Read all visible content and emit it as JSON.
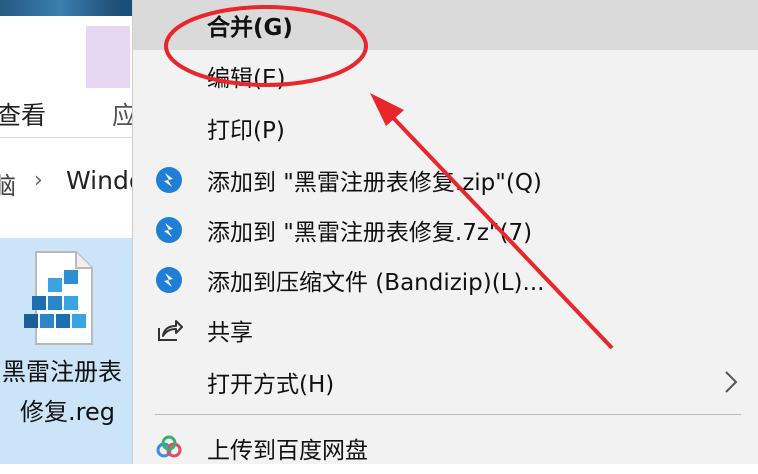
{
  "explorer": {
    "view_tab_label": "查看",
    "partial_tab_label": "应",
    "address_prefix": "脑",
    "address_separator": "›",
    "address_path": "Windo",
    "file_name_line1": "黑雷注册表",
    "file_name_line2": "修复.reg"
  },
  "context_menu": {
    "items": [
      {
        "label": "合并(G)",
        "icon": null,
        "highlighted": true
      },
      {
        "label": "编辑(E)",
        "icon": null
      },
      {
        "label": "打印(P)",
        "icon": null
      },
      {
        "label": "添加到 \"黑雷注册表修复.zip\"(Q)",
        "icon": "bandizip-icon"
      },
      {
        "label": "添加到 \"黑雷注册表修复.7z\"(7)",
        "icon": "bandizip-icon"
      },
      {
        "label": "添加到压缩文件 (Bandizip)(L)...",
        "icon": "bandizip-icon"
      },
      {
        "label": "共享",
        "icon": "share-icon"
      },
      {
        "label": "打开方式(H)",
        "icon": null,
        "submenu": true
      },
      {
        "label": "上传到百度网盘",
        "icon": "baidu-netdisk-icon"
      }
    ]
  },
  "colors": {
    "menu_bg": "#f2f2f2",
    "highlight_bg": "#dadada",
    "annotation_red": "#e8262b",
    "bandizip_blue": "#1f7fd6",
    "file_selection": "#cce4f7"
  }
}
